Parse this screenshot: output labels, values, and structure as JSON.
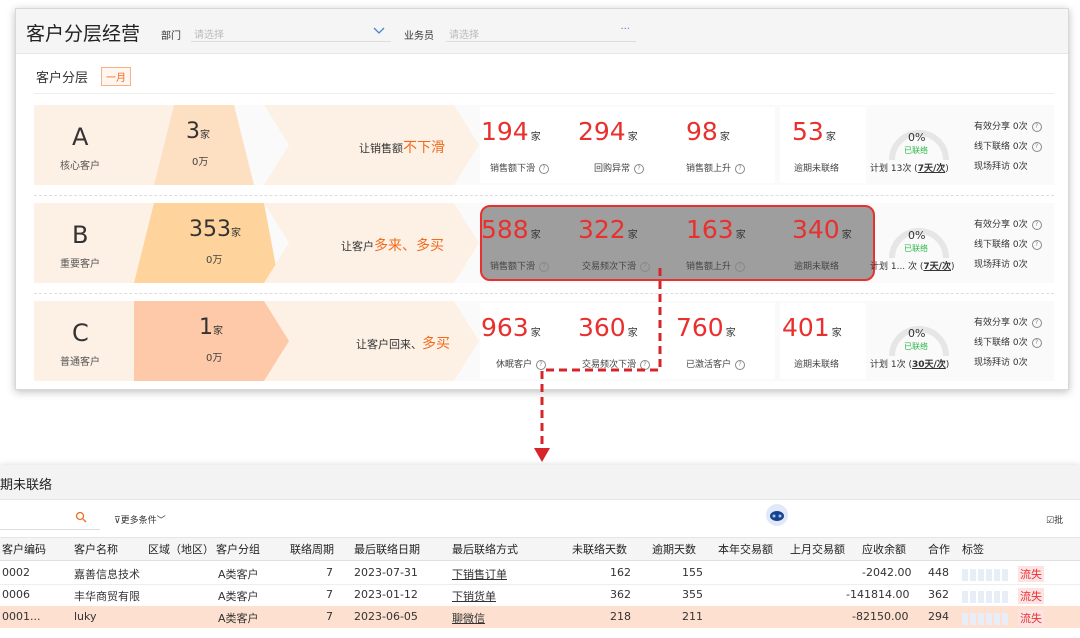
{
  "header": {
    "title": "客户分层经营",
    "dept_label": "部门",
    "dept_placeholder": "请选择",
    "sales_label": "业务员",
    "sales_placeholder": "请选择",
    "more": "···"
  },
  "section": {
    "title": "客户分层",
    "badge": "一月"
  },
  "tiers": [
    {
      "letter": "A",
      "name": "核心客户",
      "count": "3",
      "unit": "家",
      "money": "0万",
      "slogan_pre": "让销售额",
      "slogan_hl": "不下滑",
      "metrics": [
        {
          "value": "194",
          "unit": "家",
          "label": "销售额下滑"
        },
        {
          "value": "294",
          "unit": "家",
          "label": "回购异常"
        },
        {
          "value": "98",
          "unit": "家",
          "label": "销售额上升"
        },
        {
          "value": "53",
          "unit": "家",
          "label": "逾期未联络"
        }
      ],
      "gauge_pct": "0%",
      "gauge_status": "已联络",
      "plan_pre": "计划 13次 (",
      "plan_link": "7天/次",
      "plan_post": ")",
      "share": "有效分享 0次",
      "offline": "线下联络 0次",
      "visit": "现场拜访 0次"
    },
    {
      "letter": "B",
      "name": "重要客户",
      "count": "353",
      "unit": "家",
      "money": "0万",
      "slogan_pre": "让客户",
      "slogan_hl": "多来、多买",
      "metrics": [
        {
          "value": "588",
          "unit": "家",
          "label": "销售额下滑"
        },
        {
          "value": "322",
          "unit": "家",
          "label": "交易频次下滑"
        },
        {
          "value": "163",
          "unit": "家",
          "label": "销售额上升"
        },
        {
          "value": "340",
          "unit": "家",
          "label": "逾期未联络"
        }
      ],
      "gauge_pct": "0%",
      "gauge_status": "已联络",
      "plan_pre": "计划 1... 次 (",
      "plan_link": "7天/次",
      "plan_post": ")",
      "share": "有效分享 0次",
      "offline": "线下联络 0次",
      "visit": "现场拜访 0次"
    },
    {
      "letter": "C",
      "name": "普通客户",
      "count": "1",
      "unit": "家",
      "money": "0万",
      "slogan_pre": "让客户回来、",
      "slogan_hl": "多买",
      "metrics": [
        {
          "value": "963",
          "unit": "家",
          "label": "休眠客户"
        },
        {
          "value": "360",
          "unit": "家",
          "label": "交易频次下滑"
        },
        {
          "value": "760",
          "unit": "家",
          "label": "已激活客户"
        },
        {
          "value": "401",
          "unit": "家",
          "label": "逾期未联络"
        }
      ],
      "gauge_pct": "0%",
      "gauge_status": "已联络",
      "plan_pre": "计划 1次 (",
      "plan_link": "30天/次",
      "plan_post": ")",
      "share": "有效分享 0次",
      "offline": "线下联络 0次",
      "visit": "现场拜访 0次"
    }
  ],
  "detail": {
    "title": "期未联络",
    "more_filters": "更多条件",
    "batch": "批",
    "columns": [
      "客户编码",
      "客户名称",
      "区域（地区）",
      "客户分组",
      "联络周期",
      "最后联络日期",
      "最后联络方式",
      "未联络天数",
      "逾期天数",
      "本年交易额",
      "上月交易额",
      "应收余额",
      "合作",
      "标签"
    ],
    "rows": [
      {
        "code": "0002",
        "name": "嘉善信息技术",
        "region": "",
        "group": "A类客户",
        "cycle": "7",
        "last_date": "2023-07-31",
        "method": "下销售订单",
        "days": "162",
        "overdue": "155",
        "year": "",
        "month": "",
        "balance": "-2042.00",
        "coop": "448",
        "tag": "流失"
      },
      {
        "code": "0006",
        "name": "丰华商贸有限",
        "region": "",
        "group": "A类客户",
        "cycle": "7",
        "last_date": "2023-01-12",
        "method": "下销货单",
        "days": "362",
        "overdue": "355",
        "year": "",
        "month": "",
        "balance": "-141814.00",
        "coop": "362",
        "tag": "流失"
      },
      {
        "code": "0001...",
        "name": "luky",
        "region": "",
        "group": "A类客户",
        "cycle": "7",
        "last_date": "2023-06-05",
        "method": "聊微信",
        "days": "218",
        "overdue": "211",
        "year": "",
        "month": "",
        "balance": "-82150.00",
        "coop": "294",
        "tag": "流失"
      }
    ]
  },
  "colors": {
    "accent_red": "#e8312f",
    "accent_orange": "#f26b1d",
    "green": "#2db84b"
  }
}
